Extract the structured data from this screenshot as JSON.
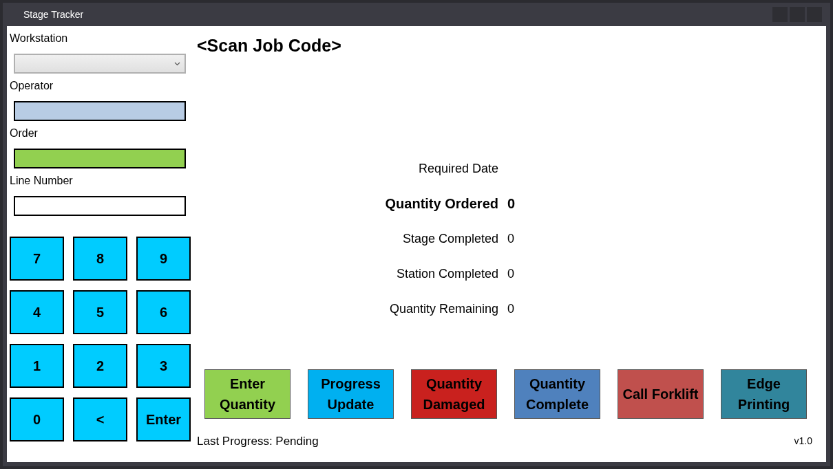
{
  "window": {
    "title": "Stage Tracker"
  },
  "fields": [
    {
      "label": "Workstation",
      "kind": "dropdown"
    },
    {
      "label": "Operator",
      "kind": "text",
      "color": "#b8cce4"
    },
    {
      "label": "Order",
      "kind": "text",
      "color": "#92d050"
    },
    {
      "label": "Line Number",
      "kind": "text",
      "color": "#ffffff"
    }
  ],
  "keypad": [
    "7",
    "8",
    "9",
    "4",
    "5",
    "6",
    "1",
    "2",
    "3",
    "0",
    "<",
    "Enter"
  ],
  "heading": "<Scan Job Code>",
  "details": [
    {
      "label": "Required Date",
      "emphasis": false
    },
    {
      "label": "Quantity Ordered",
      "value": "0",
      "emphasis": true
    },
    {
      "label": "Stage Completed",
      "value": "0",
      "emphasis": false
    },
    {
      "label": "Station Completed",
      "value": "0",
      "emphasis": false
    },
    {
      "label": "Quantity Remaining",
      "value": "0",
      "emphasis": false
    }
  ],
  "actions": [
    {
      "label": "Enter Quantity",
      "color": "#92d050"
    },
    {
      "label": "Progress Update",
      "color": "#00b0f0"
    },
    {
      "label": "Quantity Damaged",
      "color": "#c9211e"
    },
    {
      "label": "Quantity Complete",
      "color": "#4f81bd"
    },
    {
      "label": "Call Forklift",
      "color": "#c0504d"
    },
    {
      "label": "Edge Printing",
      "color": "#31859c"
    }
  ],
  "status": "Last Progress: Pending",
  "version": "v1.0"
}
